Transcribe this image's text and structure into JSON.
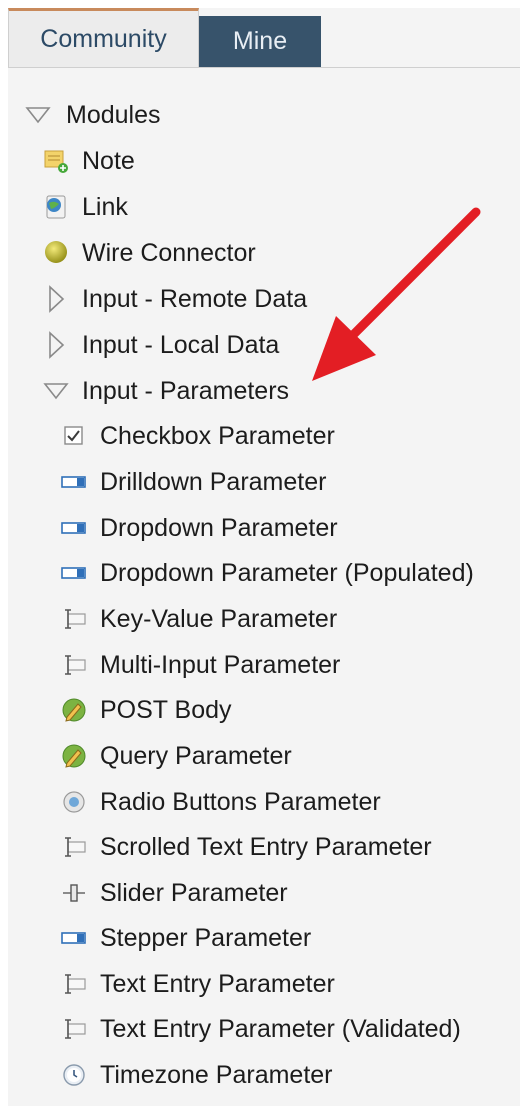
{
  "tabs": [
    {
      "label": "Community",
      "active": true
    },
    {
      "label": "Mine",
      "active": false
    }
  ],
  "tree": {
    "root": {
      "label": "Modules",
      "expanded": true
    },
    "items": [
      {
        "label": "Note",
        "icon": "note-icon"
      },
      {
        "label": "Link",
        "icon": "link-icon"
      },
      {
        "label": "Wire Connector",
        "icon": "wire-connector-icon"
      },
      {
        "label": "Input - Remote Data",
        "icon": "collapsed-triangle-icon"
      },
      {
        "label": "Input - Local Data",
        "icon": "collapsed-triangle-icon"
      },
      {
        "label": "Input - Parameters",
        "icon": "expanded-triangle-icon",
        "expanded": true
      }
    ],
    "parameters": [
      {
        "label": "Checkbox Parameter",
        "icon": "checkbox-icon"
      },
      {
        "label": "Drilldown Parameter",
        "icon": "dropdown-field-icon"
      },
      {
        "label": "Dropdown Parameter",
        "icon": "dropdown-field-icon"
      },
      {
        "label": "Dropdown Parameter (Populated)",
        "icon": "dropdown-field-icon"
      },
      {
        "label": "Key-Value Parameter",
        "icon": "text-cursor-icon"
      },
      {
        "label": "Multi-Input Parameter",
        "icon": "text-cursor-icon"
      },
      {
        "label": "POST Body",
        "icon": "pencil-globe-icon"
      },
      {
        "label": "Query Parameter",
        "icon": "pencil-globe-icon"
      },
      {
        "label": "Radio Buttons Parameter",
        "icon": "radio-button-icon"
      },
      {
        "label": "Scrolled Text Entry Parameter",
        "icon": "text-cursor-icon"
      },
      {
        "label": "Slider Parameter",
        "icon": "slider-icon"
      },
      {
        "label": "Stepper Parameter",
        "icon": "dropdown-field-icon"
      },
      {
        "label": "Text Entry Parameter",
        "icon": "text-cursor-icon"
      },
      {
        "label": "Text Entry Parameter (Validated)",
        "icon": "text-cursor-icon"
      },
      {
        "label": "Timezone Parameter",
        "icon": "clock-icon"
      }
    ]
  },
  "colors": {
    "tab_active_bg": "#ececec",
    "tab_inactive_bg": "#37536b",
    "tab_accent": "#c88a5c",
    "arrow": "#e31e24",
    "icon_blue": "#2f6fb8"
  }
}
